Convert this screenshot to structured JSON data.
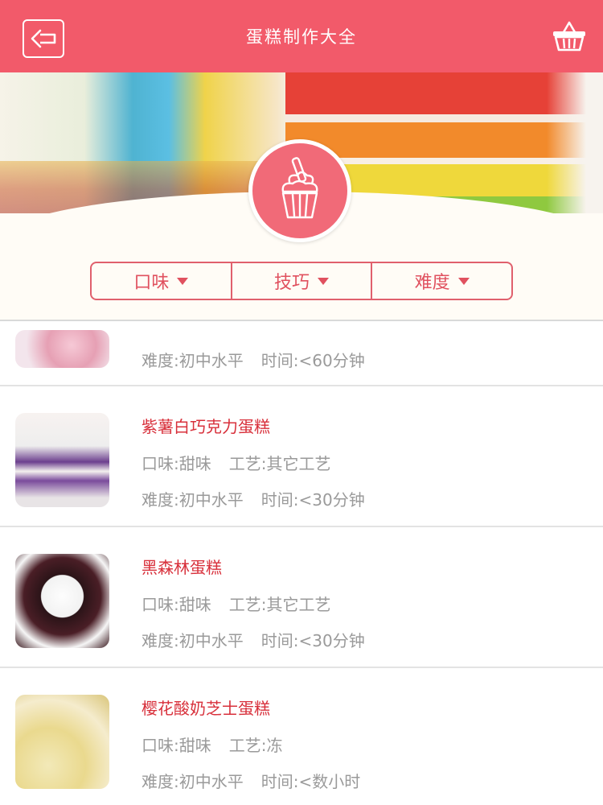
{
  "header": {
    "title": "蛋糕制作大全"
  },
  "filters": [
    {
      "label": "口味"
    },
    {
      "label": "技巧"
    },
    {
      "label": "难度"
    }
  ],
  "recipes": [
    {
      "name": "",
      "taste": "",
      "craft": "",
      "difficulty": "难度:初中水平",
      "time": "时间:<60分钟"
    },
    {
      "name": "紫薯白巧克力蛋糕",
      "taste": "口味:甜味",
      "craft": "工艺:其它工艺",
      "difficulty": "难度:初中水平",
      "time": "时间:<30分钟"
    },
    {
      "name": "黑森林蛋糕",
      "taste": "口味:甜味",
      "craft": "工艺:其它工艺",
      "difficulty": "难度:初中水平",
      "time": "时间:<30分钟"
    },
    {
      "name": "樱花酸奶芝士蛋糕",
      "taste": "口味:甜味",
      "craft": "工艺:冻",
      "difficulty": "难度:初中水平",
      "time": "时间:<数小时"
    }
  ],
  "icons": {
    "back": "back-arrow-icon",
    "basket": "basket-icon",
    "badge": "ice-cream-icon"
  },
  "colors": {
    "accent": "#f25a6a",
    "recipe_name": "#d8303b",
    "meta_text": "#9a9a9a"
  }
}
